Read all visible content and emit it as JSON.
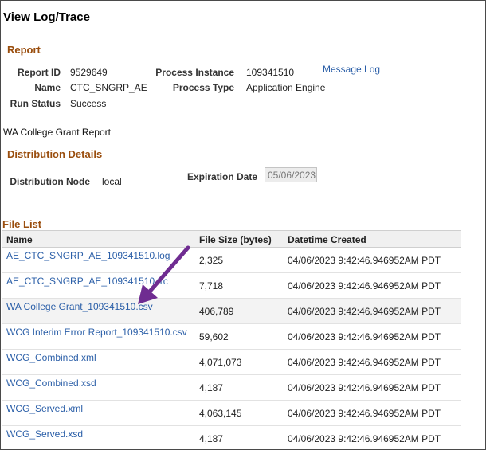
{
  "page": {
    "title": "View Log/Trace"
  },
  "report": {
    "section_title": "Report",
    "report_id_label": "Report ID",
    "report_id": "9529649",
    "process_instance_label": "Process Instance",
    "process_instance": "109341510",
    "message_log_link": "Message Log",
    "name_label": "Name",
    "name": "CTC_SNGRP_AE",
    "process_type_label": "Process Type",
    "process_type": "Application Engine",
    "run_status_label": "Run Status",
    "run_status": "Success"
  },
  "description": "WA College Grant Report",
  "distribution": {
    "section_title": "Distribution Details",
    "node_label": "Distribution Node",
    "node": "local",
    "expiration_label": "Expiration Date",
    "expiration_date": "05/06/2023"
  },
  "file_list": {
    "section_title": "File List",
    "columns": [
      "Name",
      "File Size (bytes)",
      "Datetime Created"
    ],
    "rows": [
      {
        "name": "AE_CTC_SNGRP_AE_109341510.log",
        "size": "2,325",
        "datetime": "04/06/2023  9:42:46.946952AM PDT"
      },
      {
        "name": "AE_CTC_SNGRP_AE_109341510.trc",
        "size": "7,718",
        "datetime": "04/06/2023  9:42:46.946952AM PDT"
      },
      {
        "name": "WA College Grant_109341510.csv",
        "size": "406,789",
        "datetime": "04/06/2023  9:42:46.946952AM PDT"
      },
      {
        "name": "WCG Interim Error Report_109341510.csv",
        "size": "59,602",
        "datetime": "04/06/2023  9:42:46.946952AM PDT"
      },
      {
        "name": "WCG_Combined.xml",
        "size": "4,071,073",
        "datetime": "04/06/2023  9:42:46.946952AM PDT"
      },
      {
        "name": "WCG_Combined.xsd",
        "size": "4,187",
        "datetime": "04/06/2023  9:42:46.946952AM PDT"
      },
      {
        "name": "WCG_Served.xml",
        "size": "4,063,145",
        "datetime": "04/06/2023  9:42:46.946952AM PDT"
      },
      {
        "name": "WCG_Served.xsd",
        "size": "4,187",
        "datetime": "04/06/2023  9:42:46.946952AM PDT"
      }
    ]
  },
  "colors": {
    "accent": "#9a4e0e",
    "link": "#2b5fa8",
    "arrow": "#6f2c91"
  },
  "annotation": {
    "icon": "arrow-annotation-icon"
  }
}
